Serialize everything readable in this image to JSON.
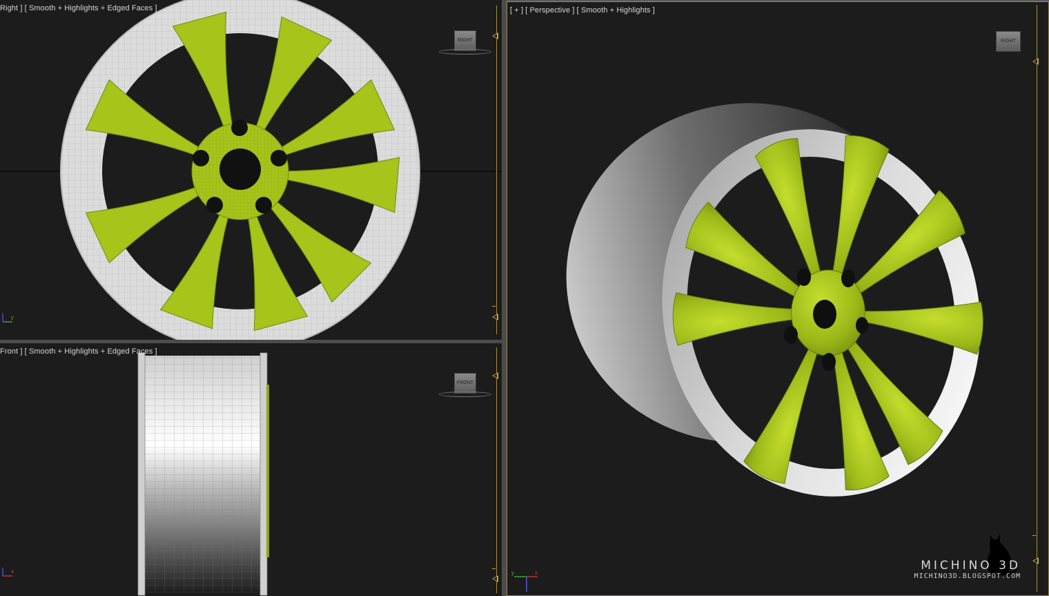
{
  "viewports": {
    "right": {
      "label": "Right ] [ Smooth + Highlights + Edged Faces ]",
      "viewcube_label": "RIGHT",
      "axis_a": "y",
      "axis_b": "z"
    },
    "front": {
      "label": "Front ] [ Smooth + Highlights + Edged Faces ]",
      "viewcube_label": "FRONT",
      "axis_a": "x",
      "axis_b": "z"
    },
    "perspective": {
      "label": "[ + ] [ Perspective ] [ Smooth + Highlights ]",
      "viewcube_label": "RIGHT",
      "axis_a": "x",
      "axis_b": "y"
    }
  },
  "watermark": {
    "title": "MICHINO 3D",
    "url": "MICHINO3D.BLOGSPOT.COM"
  },
  "colors": {
    "viewport_bg": "#1c1c1c",
    "spoke_green": "#a6c41a",
    "rim_grey": "#c8c8c8",
    "frame_accent": "#a08a4a"
  }
}
